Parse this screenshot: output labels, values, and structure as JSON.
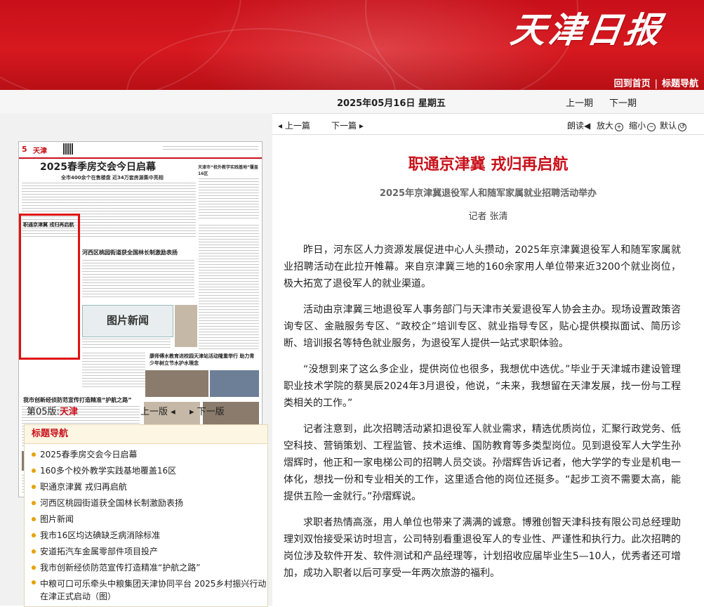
{
  "header": {
    "logo_text": "天津日报",
    "nav": [
      "回到首页",
      "标题导航"
    ],
    "date": "2025年05月16日  星期五",
    "prev_issue": "上一期",
    "next_issue": "下一期"
  },
  "page_preview": {
    "page_no": "5",
    "page_label": "天津",
    "headline": "2025春季房交会今日启幕",
    "subhead": "全市400余个在售楼盘 近34万套房源集中亮相",
    "right_head": "天津市“校外教学实践基地”覆盖16区",
    "story2": "河西区桃园街道获全国林长制激励表扬",
    "photo_news": "图片新闻",
    "story3": "康师傅水教育进校园天津站活动隆重举行 助力青少年树立节水护水理念",
    "story4": "我市创新经侦防范宣传打造精准“护航之路”",
    "highlight": "职通京津冀 戎归再启航"
  },
  "edition": {
    "label": "第05版:",
    "name": "天津",
    "prev": "上一版",
    "next": "下一版"
  },
  "toc": {
    "title": "标题导航",
    "items": [
      "2025春季房交会今日启幕",
      "160多个校外教学实践基地覆盖16区",
      "职通京津冀 戎归再启航",
      "河西区桃园街道获全国林长制激励表扬",
      "图片新闻",
      "我市16区均达碘缺乏病消除标准",
      "安道拓汽车金属零部件项目投产",
      "我市创新经侦防范宣传打造精准“护航之路”",
      "中粮可口可乐牵头中粮集团天津协同平台 2025乡村振兴行动在津正式启动（图）"
    ]
  },
  "article_bar": {
    "prev": "上一篇",
    "next": "下一篇",
    "read": "朗读",
    "zoom_in": "放大",
    "zoom_out": "缩小",
    "default": "默认"
  },
  "article": {
    "title": "职通京津冀  戎归再启航",
    "subtitle": "2025年京津冀退役军人和随军家属就业招聘活动举办",
    "author": "记者  张清",
    "paragraphs": [
      "昨日，河东区人力资源发展促进中心人头攒动，2025年京津冀退役军人和随军家属就业招聘活动在此拉开帷幕。来自京津冀三地的160余家用人单位带来近3200个就业岗位，极大拓宽了退役军人的就业渠道。",
      "活动由京津冀三地退役军人事务部门与天津市关爱退役军人协会主办。现场设置政策咨询专区、金融服务专区、“政校企”培训专区、就业指导专区，贴心提供模拟面试、简历诊断、培训报名等特色就业服务，为退役军人提供一站式求职体验。",
      "“没想到来了这么多企业，提供岗位也很多，我想优中选优。”毕业于天津城市建设管理职业技术学院的蔡昊辰2024年3月退役，他说，“未来，我想留在天津发展，找一份与工程类相关的工作。”",
      "记者注意到，此次招聘活动紧扣退役军人就业需求，精选优质岗位，汇聚行政党务、低空科技、营销策划、工程监管、技术运维、国防教育等多类型岗位。见到退役军人大学生孙熠辉时，他正和一家电梯公司的招聘人员交谈。孙熠辉告诉记者，他大学学的专业是机电一体化，想找一份和专业相关的工作，这里适合他的岗位还挺多。“起步工资不需要太高，能提供五险一金就行。”孙熠辉说。",
      "求职者热情高涨，用人单位也带来了满满的诚意。博雅创智天津科技有限公司总经理助理刘双怡接受采访时坦言，公司特别看重退役军人的专业性、严谨性和执行力。此次招聘的岗位涉及软件开发、软件测试和产品经理等，计划招收应届毕业生5—10人，优秀者还可增加，成功入职者以后可享受一年两次旅游的福利。"
    ]
  },
  "colors": {
    "brand_red": "#c8101a",
    "toc_bullet": "#e6a100"
  }
}
